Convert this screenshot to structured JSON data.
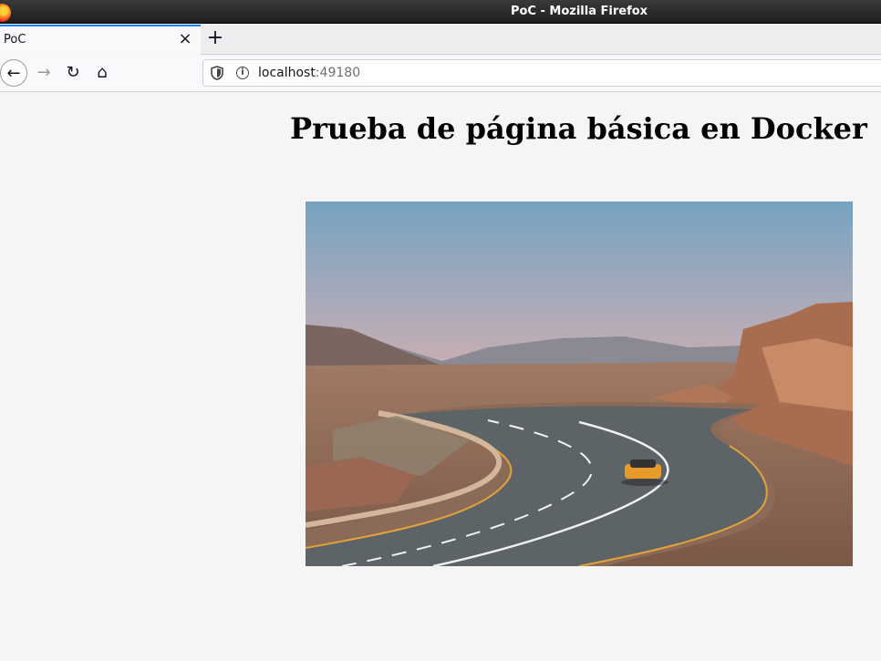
{
  "window": {
    "title": "PoC - Mozilla Firefox"
  },
  "tabs": [
    {
      "label": "PoC"
    }
  ],
  "toolbar": {
    "close_tab_label": "×",
    "new_tab_label": "+",
    "back_label": "←",
    "forward_label": "→",
    "reload_label": "↻",
    "home_label": "⌂"
  },
  "urlbar": {
    "host": "localhost",
    "port": ":49180"
  },
  "page": {
    "heading": "Prueba de página básica en Docker"
  },
  "icons": [
    "firefox-logo",
    "close-icon",
    "plus-icon",
    "back-arrow-icon",
    "forward-arrow-icon",
    "reload-icon",
    "home-icon",
    "shield-icon",
    "info-icon"
  ]
}
